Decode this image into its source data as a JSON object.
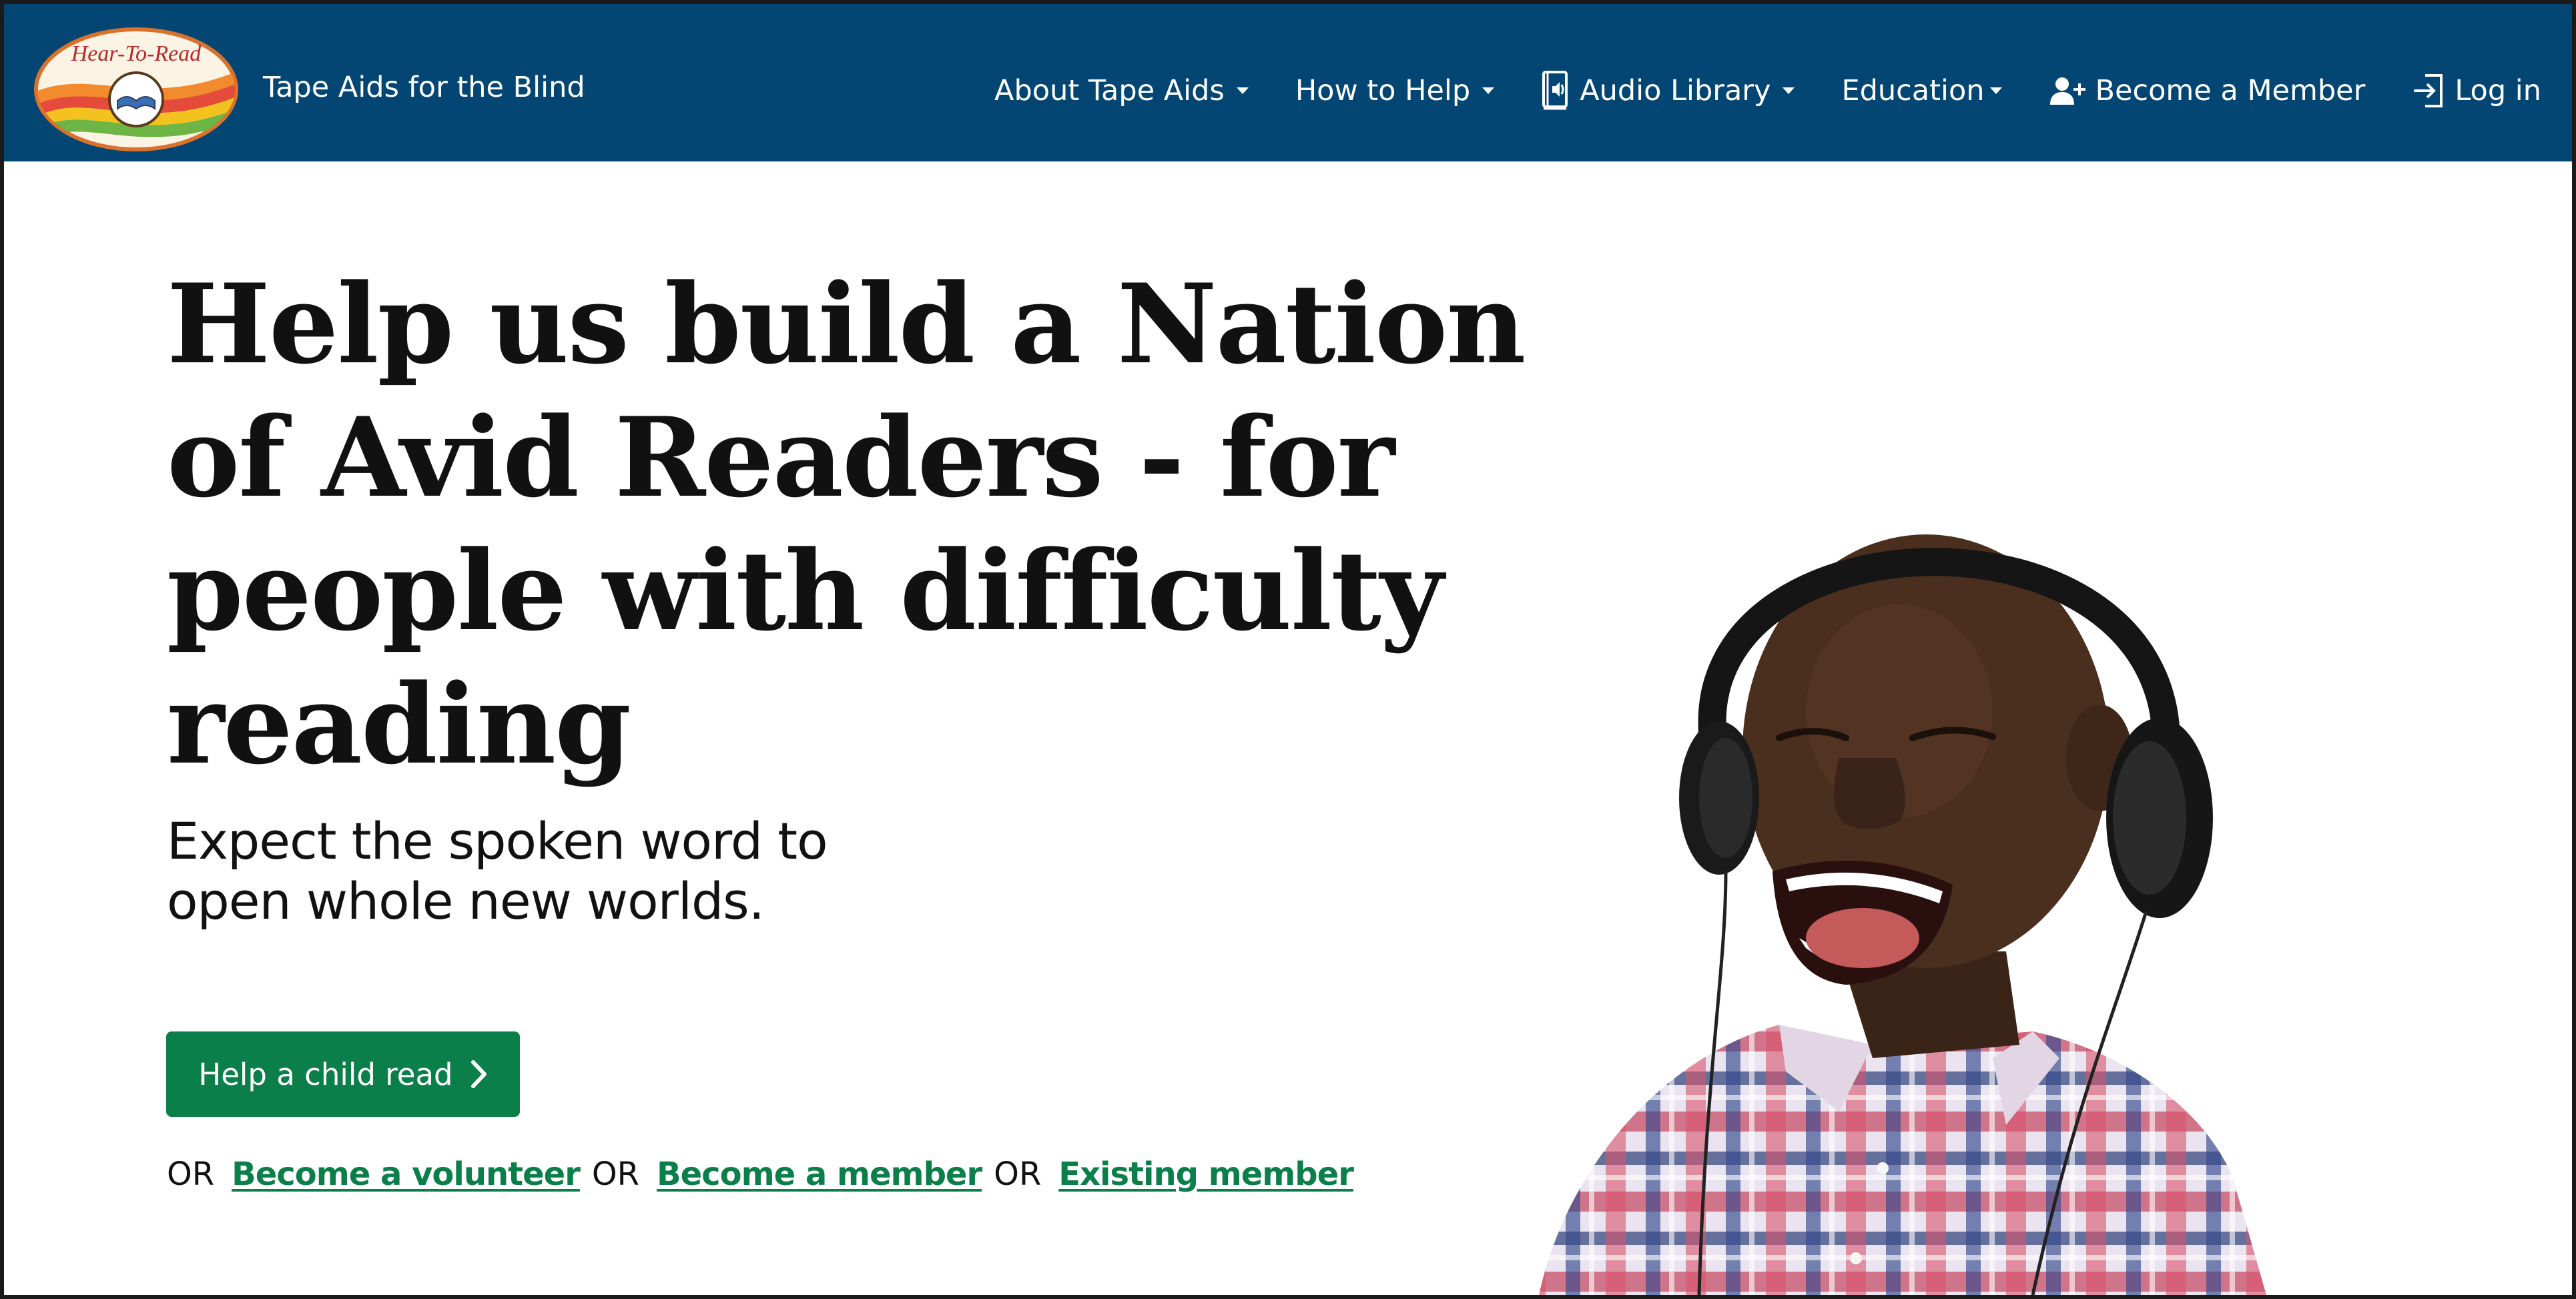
{
  "header": {
    "brand_name": "Tape Aids for the Blind",
    "logo": {
      "text": "Hear-To-Read",
      "icon": "open-book-icon"
    },
    "nav": [
      {
        "label": "About Tape Aids",
        "dropdown": true
      },
      {
        "label": "How to Help",
        "dropdown": true
      },
      {
        "label": "Audio Library",
        "dropdown": true,
        "icon": "audio-book-icon"
      },
      {
        "label": "Education",
        "dropdown": true
      },
      {
        "label": "Become a Member",
        "icon": "add-user-icon"
      },
      {
        "label": "Log in",
        "icon": "login-icon"
      }
    ]
  },
  "hero": {
    "title_lines": [
      "Help us build a Nation",
      "of Avid Readers - for",
      "people with difficulty",
      "reading"
    ],
    "subtitle_lines": [
      "Expect the spoken word to",
      "open whole new worlds."
    ],
    "cta": {
      "label": "Help a child read",
      "icon": "chevron-right-icon"
    },
    "alternatives": {
      "or_text": "OR",
      "links": [
        "Become a volunteer",
        "Become a member",
        "Existing member"
      ]
    }
  },
  "colors": {
    "navbar": "#034674",
    "accent_green": "#0b7f49",
    "text": "#111111",
    "background": "#ffffff"
  }
}
